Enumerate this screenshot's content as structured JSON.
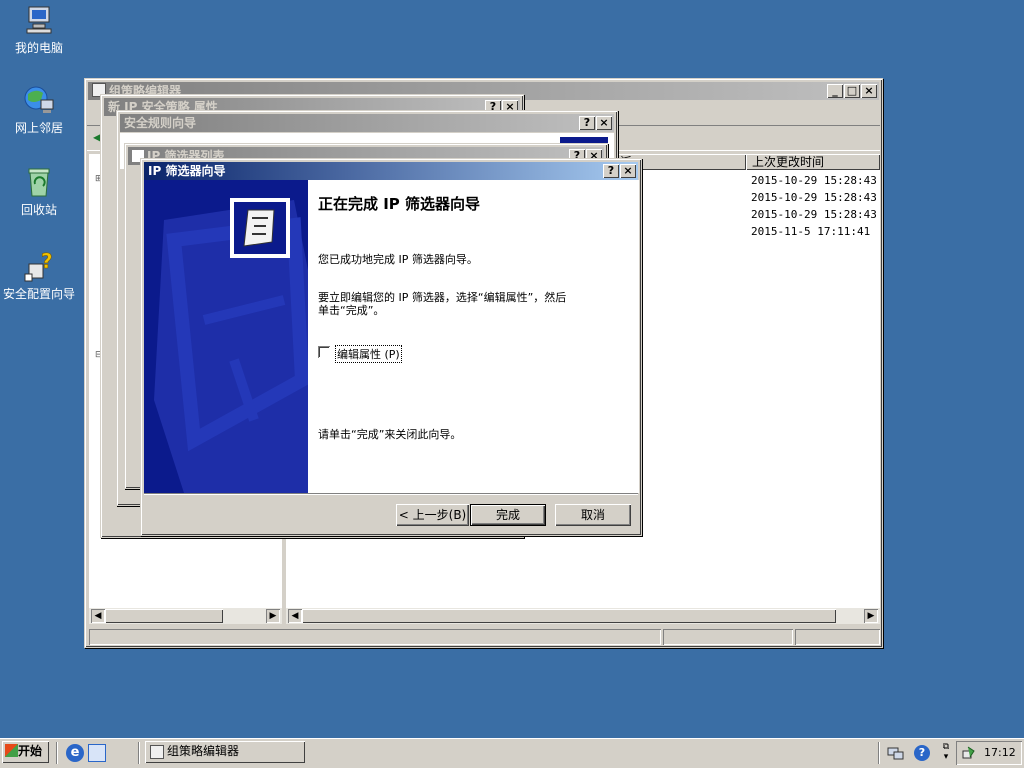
{
  "desktop": {
    "icons": [
      {
        "label": "我的电脑",
        "icon": "my-computer-icon"
      },
      {
        "label": "网上邻居",
        "icon": "network-places-icon"
      },
      {
        "label": "回收站",
        "icon": "recycle-bin-icon"
      },
      {
        "label": "安全配置向导",
        "icon": "security-wizard-icon"
      }
    ]
  },
  "gpe": {
    "title": "组策略编辑器",
    "list_headers": [
      "上次更改时间"
    ],
    "list_header_partial": "派",
    "rows": [
      {
        "modified": "2015-10-29 15:28:43"
      },
      {
        "modified": "2015-10-29 15:28:43"
      },
      {
        "modified": "2015-10-29 15:28:43"
      },
      {
        "modified": "2015-11-5 17:11:41"
      }
    ]
  },
  "ipsec_props": {
    "title": "新 IP 安全策略 属性"
  },
  "rule_wizard": {
    "title": "安全规则向导"
  },
  "filter_list": {
    "title": "IP 筛选器列表"
  },
  "wizard": {
    "title": "IP 筛选器向导",
    "heading": "正在完成 IP 筛选器向导",
    "msg1": "您已成功地完成 IP 筛选器向导。",
    "msg2_line1": "要立即编辑您的 IP 筛选器，选择“编辑属性”，然后",
    "msg2_line2": "单击“完成”。",
    "checkbox_label": "编辑属性 (P)",
    "checkbox_checked": false,
    "msg3": "请单击“完成”来关闭此向导。",
    "back_button": "< 上一步(B)",
    "finish_button": "完成",
    "cancel_button": "取消"
  },
  "taskbar": {
    "start_label": "开始",
    "task_label": "组策略编辑器",
    "clock": "17:12"
  },
  "colors": {
    "desktop": "#3a6ea5",
    "active_title_start": "#0a246a",
    "active_title_end": "#a6caf0",
    "wizard_banner": "#0b1a8c"
  }
}
